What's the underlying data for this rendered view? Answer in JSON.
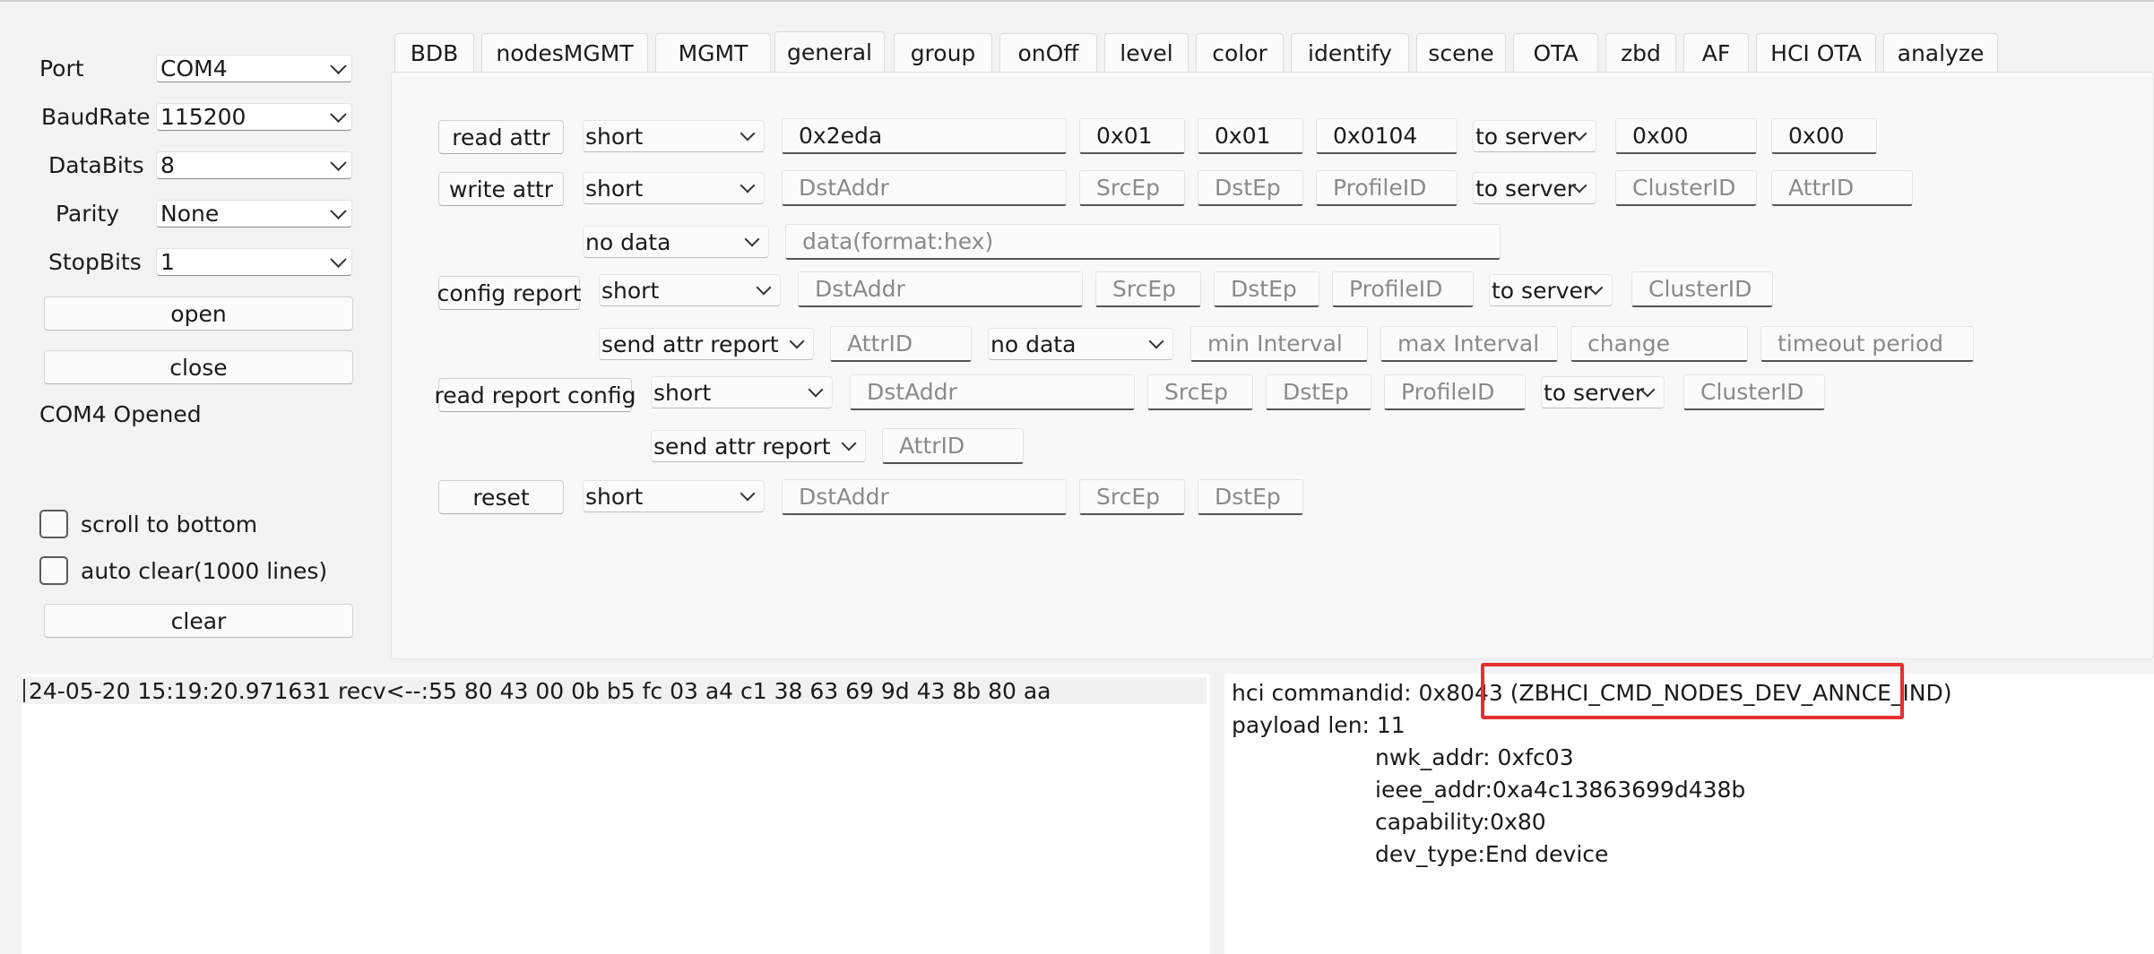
{
  "serial": {
    "port_label": "Port",
    "port_value": "COM4",
    "baud_label": "BaudRate",
    "baud_value": "115200",
    "databits_label": "DataBits",
    "databits_value": "8",
    "parity_label": "Parity",
    "parity_value": "None",
    "stopbits_label": "StopBits",
    "stopbits_value": "1",
    "open_label": "open",
    "close_label": "close",
    "status": "COM4 Opened"
  },
  "options": {
    "scroll_label": "scroll to bottom",
    "scroll_checked": false,
    "autoclear_label": "auto clear(1000 lines)",
    "autoclear_checked": false,
    "clear_label": "clear"
  },
  "tabs": [
    "BDB",
    "nodesMGMT",
    "MGMT",
    "general",
    "group",
    "onOff",
    "level",
    "color",
    "identify",
    "scene",
    "OTA",
    "zbd",
    "AF",
    "HCI OTA",
    "analyze"
  ],
  "active_tab": "general",
  "form": {
    "read_attr": {
      "button": "read attr",
      "addr_mode": "short",
      "dst_addr": "0x2eda",
      "src_ep": "0x01",
      "dst_ep": "0x01",
      "profile_id": "0x0104",
      "direction": "to server",
      "cluster_id": "0x00",
      "attr_id": "0x00"
    },
    "write_attr": {
      "button": "write attr",
      "addr_mode": "short",
      "dst_addr_ph": "DstAddr",
      "src_ep_ph": "SrcEp",
      "dst_ep_ph": "DstEp",
      "profile_id_ph": "ProfileID",
      "direction": "to server",
      "cluster_id_ph": "ClusterID",
      "attr_id_ph": "AttrID",
      "data_type": "no data",
      "data_ph": "data(format:hex)"
    },
    "config_report": {
      "button": "config report",
      "addr_mode": "short",
      "dst_addr_ph": "DstAddr",
      "src_ep_ph": "SrcEp",
      "dst_ep_ph": "DstEp",
      "profile_id_ph": "ProfileID",
      "direction": "to server",
      "cluster_id_ph": "ClusterID",
      "report_type": "send attr report",
      "attr_id_ph": "AttrID",
      "data_type": "no data",
      "min_interval_ph": "min Interval",
      "max_interval_ph": "max Interval",
      "change_ph": "change",
      "timeout_ph": "timeout period"
    },
    "read_report_config": {
      "button": "read report config",
      "addr_mode": "short",
      "dst_addr_ph": "DstAddr",
      "src_ep_ph": "SrcEp",
      "dst_ep_ph": "DstEp",
      "profile_id_ph": "ProfileID",
      "direction": "to server",
      "cluster_id_ph": "ClusterID",
      "report_type": "send attr report",
      "attr_id_ph": "AttrID"
    },
    "reset": {
      "button": "reset",
      "addr_mode": "short",
      "dst_addr_ph": "DstAddr",
      "src_ep_ph": "SrcEp",
      "dst_ep_ph": "DstEp"
    }
  },
  "log": {
    "line": "24-05-20 15:19:20.971631 recv<--:55 80 43 00 0b b5 fc 03 a4 c1 38 63 69 9d 43 8b 80 aa"
  },
  "decode": {
    "cmd_prefix": "hci commandid: 0x8043 (",
    "cmd_name": "ZBHCI_CMD_NODES_DEV_ANNCE_IND)",
    "payload_len": "payload len: 11",
    "fields": [
      "nwk_addr: 0xfc03",
      "ieee_addr:0xa4c13863699d438b",
      "capability:0x80",
      "dev_type:End device"
    ]
  },
  "colors": {
    "highlight": "#e53030"
  }
}
